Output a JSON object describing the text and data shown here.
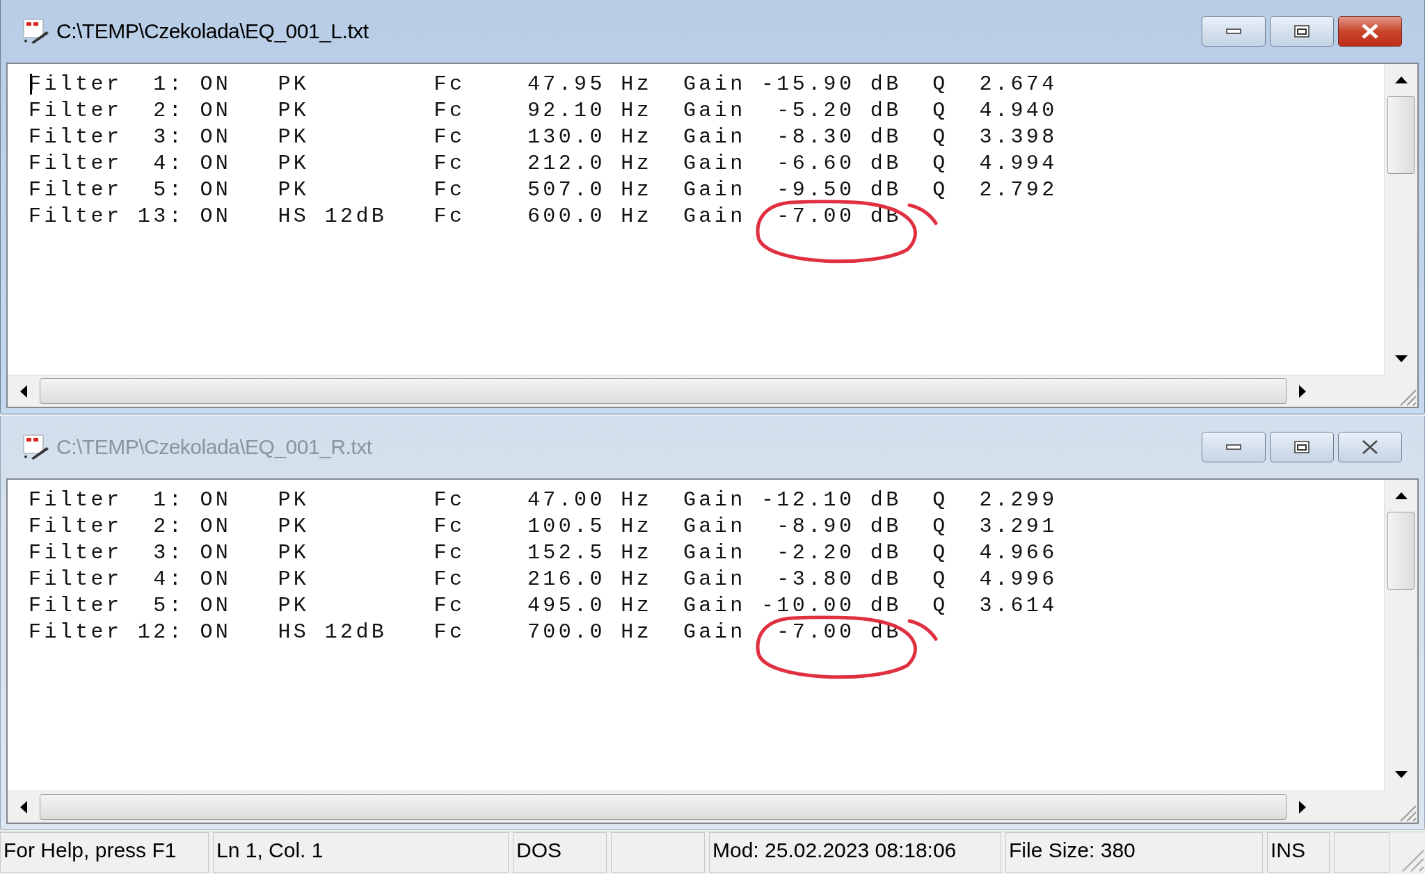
{
  "windows": [
    {
      "title": "C:\\TEMP\\Czekolada\\EQ_001_L.txt",
      "active": true,
      "cursor": true,
      "rows": [
        {
          "text": "Filter  1: ON   PK        Fc    47.95 Hz  Gain -15.90 dB  Q  2.674",
          "circled": false
        },
        {
          "text": "Filter  2: ON   PK        Fc    92.10 Hz  Gain  -5.20 dB  Q  4.940",
          "circled": false
        },
        {
          "text": "Filter  3: ON   PK        Fc    130.0 Hz  Gain  -8.30 dB  Q  3.398",
          "circled": false
        },
        {
          "text": "Filter  4: ON   PK        Fc    212.0 Hz  Gain  -6.60 dB  Q  4.994",
          "circled": false
        },
        {
          "text": "Filter  5: ON   PK        Fc    507.0 Hz  Gain  -9.50 dB  Q  2.792",
          "circled": false
        },
        {
          "text": "Filter 13: ON   HS 12dB   Fc    600.0 Hz  Gain  -7.00 dB",
          "circled": true
        }
      ]
    },
    {
      "title": "C:\\TEMP\\Czekolada\\EQ_001_R.txt",
      "active": false,
      "rows": [
        {
          "text": "Filter  1: ON   PK        Fc    47.00 Hz  Gain -12.10 dB  Q  2.299",
          "circled": false
        },
        {
          "text": "Filter  2: ON   PK        Fc    100.5 Hz  Gain  -8.90 dB  Q  3.291",
          "circled": false
        },
        {
          "text": "Filter  3: ON   PK        Fc    152.5 Hz  Gain  -2.20 dB  Q  4.966",
          "circled": false
        },
        {
          "text": "Filter  4: ON   PK        Fc    216.0 Hz  Gain  -3.80 dB  Q  4.996",
          "circled": false
        },
        {
          "text": "Filter  5: ON   PK        Fc    495.0 Hz  Gain -10.00 dB  Q  3.614",
          "circled": false
        },
        {
          "text": "Filter 12: ON   HS 12dB   Fc    700.0 Hz  Gain  -7.00 dB",
          "circled": true
        }
      ]
    }
  ],
  "status_bar": [
    "For Help, press F1",
    "Ln 1, Col. 1",
    "DOS",
    "Mod: 25.02.2023 08:18:06",
    "File Size: 380",
    "INS"
  ]
}
